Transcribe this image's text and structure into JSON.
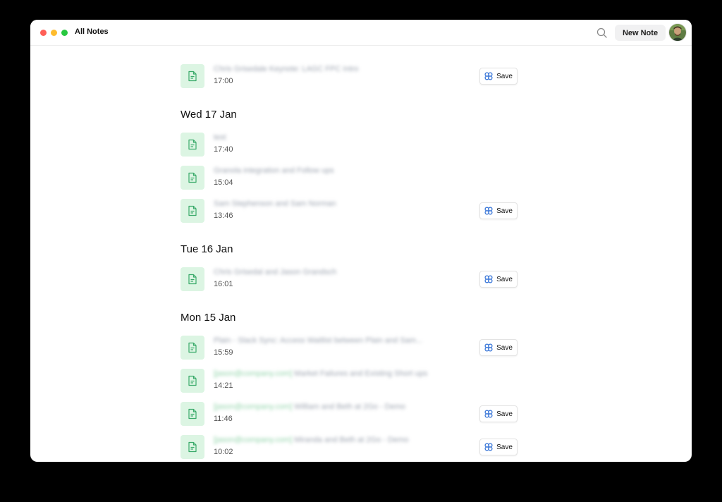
{
  "window": {
    "title": "All Notes",
    "new_note_label": "New Note",
    "traffic_colors": [
      "#ff5f57",
      "#febc2e",
      "#28c840"
    ]
  },
  "colors": {
    "note_icon_bg": "#dcf5e3",
    "note_icon_fg": "#3aaa6a",
    "save_icon": "#2f6fd6"
  },
  "icons": {
    "note": "document-icon",
    "save": "quad-circle-logo-icon",
    "search": "search-icon"
  },
  "save_label": "Save",
  "groups": [
    {
      "heading": "",
      "notes": [
        {
          "email": "",
          "title": "Chris Grisedale Keynote: LAGC FPC Intro",
          "time": "17:00",
          "save": true
        }
      ]
    },
    {
      "heading": "Wed 17 Jan",
      "notes": [
        {
          "email": "",
          "title": "test",
          "time": "17:40",
          "save": false
        },
        {
          "email": "",
          "title": "Granola integration and Follow ups",
          "time": "15:04",
          "save": false
        },
        {
          "email": "",
          "title": "Sam Stephenson and Sam Norman",
          "time": "13:46",
          "save": true
        }
      ]
    },
    {
      "heading": "Tue 16 Jan",
      "notes": [
        {
          "email": "",
          "title": "Chris Grisedal and Jason Grandsch",
          "time": "16:01",
          "save": true
        }
      ]
    },
    {
      "heading": "Mon 15 Jan",
      "notes": [
        {
          "email": "",
          "title": "Plain - Slack Sync: Access Waitlist between Plain and Sam...",
          "time": "15:59",
          "save": true
        },
        {
          "email": "[jason@company.com]",
          "title": " Market Failures and Existing Short ups",
          "time": "14:21",
          "save": false
        },
        {
          "email": "[jason@company.com]",
          "title": " William and Beth at 2Go - Demo",
          "time": "11:46",
          "save": true
        },
        {
          "email": "[jason@company.com]",
          "title": " Miranda and Beth at 2Go - Demo",
          "time": "10:02",
          "save": true
        }
      ]
    }
  ]
}
